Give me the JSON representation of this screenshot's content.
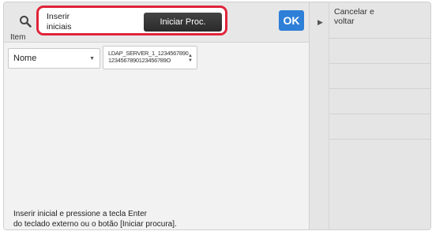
{
  "toolbar": {
    "search_icon": "search-icon",
    "input_value": "Inserir iniciais",
    "start_search_label": "Iniciar Proc.",
    "ok_label": "OK"
  },
  "filters": {
    "item_label": "Item",
    "item_value": "Nome",
    "address_book_line1": "LDAP_SERVER_1_1234567890",
    "address_book_line2": "1234567890123456789O"
  },
  "instructions": {
    "line1": "Inserir inicial e pressione a tecla Enter",
    "line2": "do teclado externo ou o botão [Iniciar procura]."
  },
  "side_panel": {
    "cancel_label_line1": "Cancelar e",
    "cancel_label_line2": "voltar"
  },
  "colors": {
    "highlight": "#e0243a",
    "ok_button": "#2e7fd8",
    "start_button": "#333333"
  }
}
